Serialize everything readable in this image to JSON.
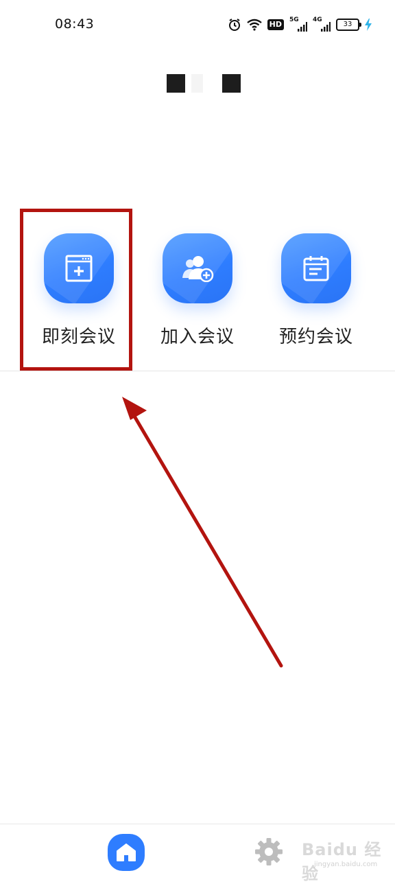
{
  "status_bar": {
    "time": "08:43",
    "hd": "HD",
    "net1": "5G",
    "net2": "4G",
    "battery": "33"
  },
  "actions": [
    {
      "label": "即刻会议",
      "icon": "new-meeting-icon"
    },
    {
      "label": "加入会议",
      "icon": "join-meeting-icon"
    },
    {
      "label": "预约会议",
      "icon": "calendar-icon"
    }
  ],
  "bottom_nav": {
    "home_icon": "home-icon",
    "settings_icon": "gear-icon"
  },
  "watermark": {
    "text": "Baidu 经验",
    "sub": "jingyan.baidu.com"
  },
  "colors": {
    "accent": "#2e7dff",
    "highlight": "#b3140f"
  }
}
